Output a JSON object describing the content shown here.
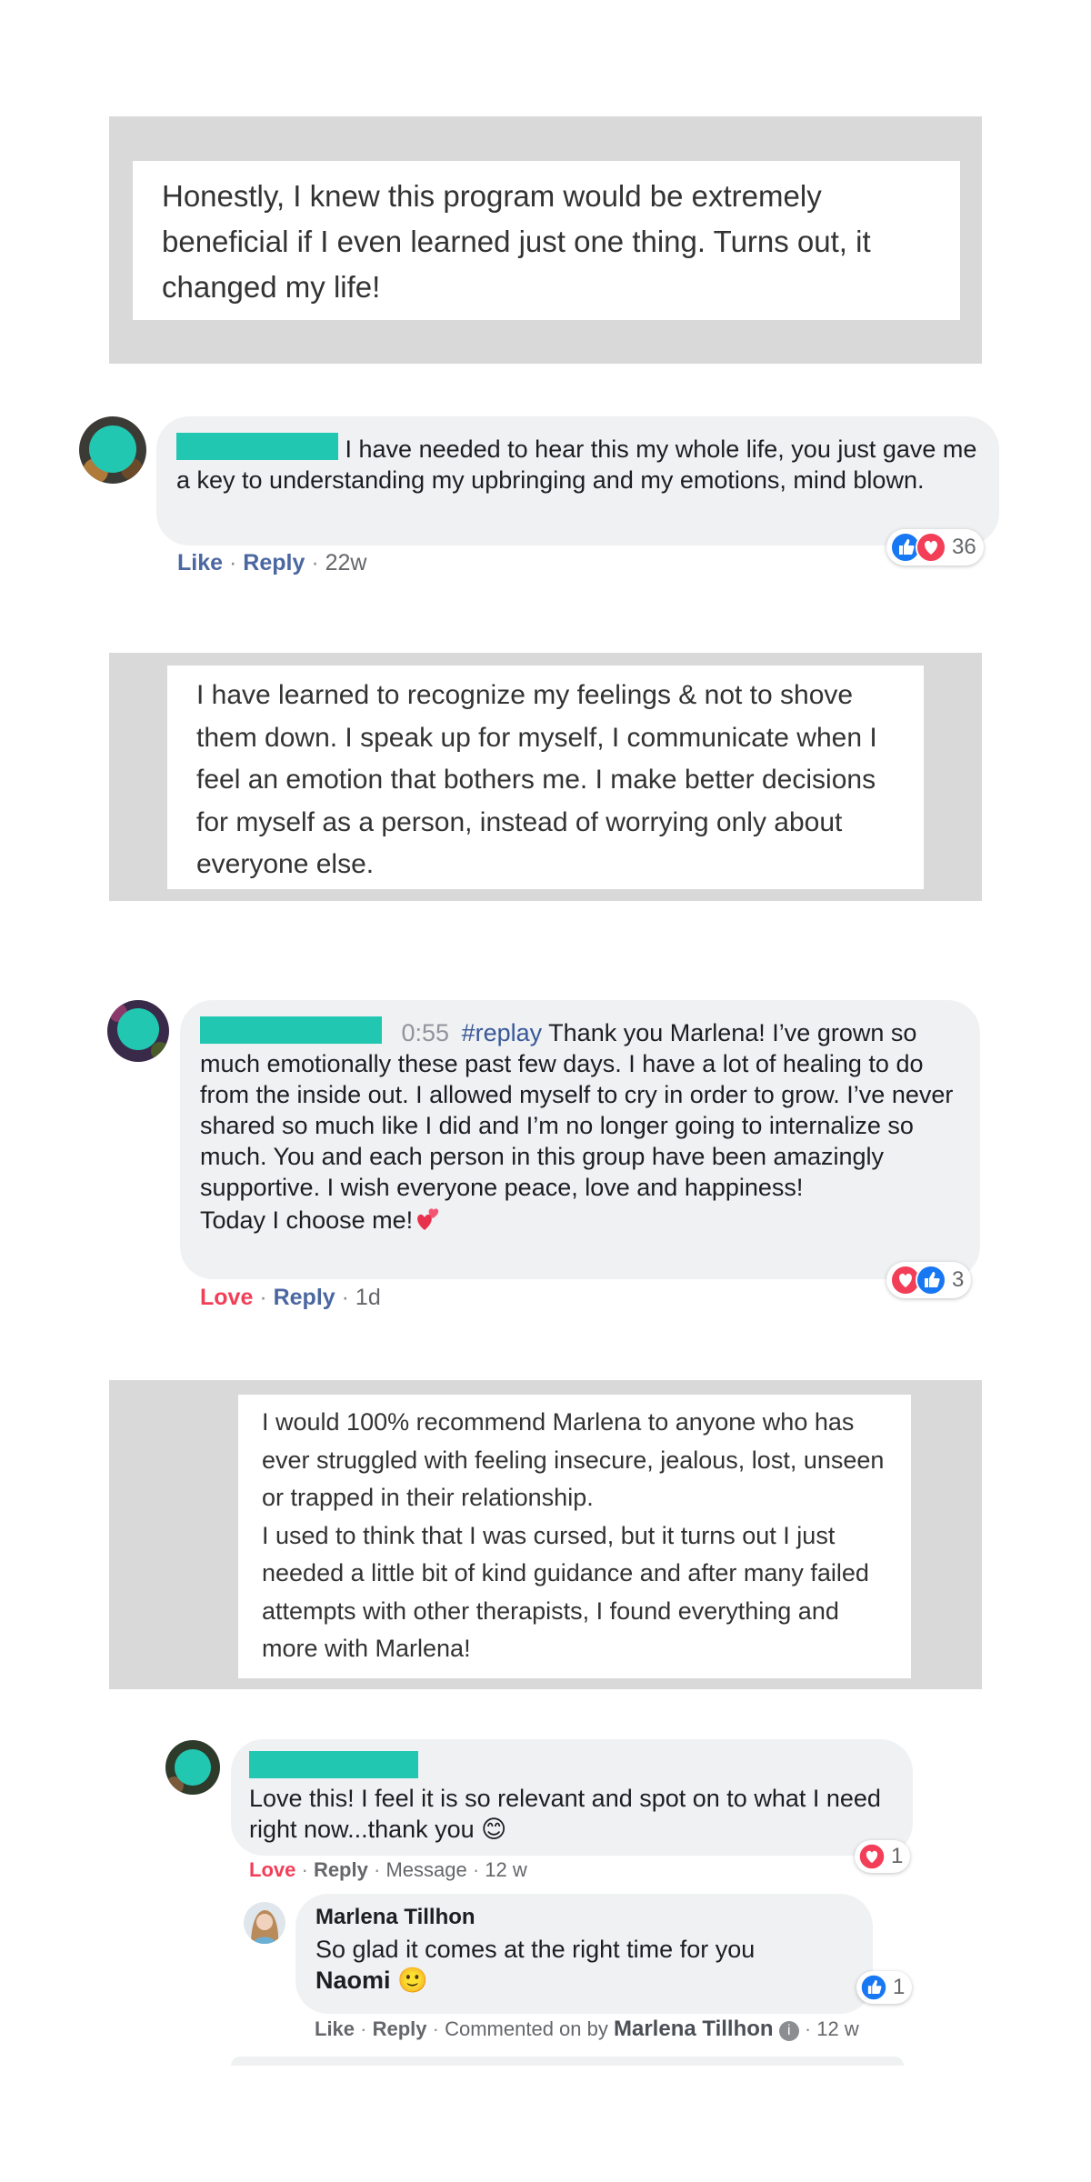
{
  "testimonials": [
    {
      "text": "Honestly, I knew this program would be extremely beneficial if I even learned just one thing. Turns out, it changed my life!"
    },
    {
      "text": "I have learned to recognize my feelings & not to shove them down. I speak up for myself, I communicate when I feel an emotion that bothers me. I make better decisions for myself as a person, instead of worrying only about everyone else."
    },
    {
      "text_p1": "I would 100% recommend Marlena to anyone who has ever struggled with feeling insecure, jealous, lost, unseen or trapped in their relationship.",
      "text_p2": "I used to think that I was cursed, but it turns out I just needed a little bit of kind guidance and after many failed attempts with other therapists, I found everything and more with Marlena!"
    }
  ],
  "comment1": {
    "text": "I have needed to hear this my whole life, you just gave me a key to understanding my upbringing and my emotions, mind blown.",
    "action": "Like",
    "reply": "Reply",
    "time": "22w",
    "reaction_count": "36",
    "reactions": [
      "like-icon",
      "love-icon"
    ]
  },
  "comment2": {
    "timestamp": "0:55",
    "hashtag": "#replay",
    "text_main": "Thank you Marlena! I’ve grown so much emotionally these past few days. I have a lot of healing to do from the inside out. I allowed myself to cry in order to grow. I’ve never shared so much like I did and I’m no longer going to internalize so much. You and each person in this group have been amazingly supportive. I wish everyone peace, love and happiness!",
    "text_last": "Today I choose me!",
    "emoji": "heart-emoji",
    "action": "Love",
    "reply": "Reply",
    "time": "1d",
    "reaction_count": "3",
    "reactions": [
      "love-icon",
      "like-icon"
    ]
  },
  "comment3": {
    "text": "Love this! I feel it is so relevant and spot on to what I need right now...thank you 😊",
    "action": "Love",
    "reply": "Reply",
    "message": "Message",
    "time": "12 w",
    "reaction_count": "1",
    "reactions": [
      "love-icon"
    ]
  },
  "reply1": {
    "author": "Marlena Tillhon",
    "text": "So glad it comes at the right time for you",
    "mention": "Naomi",
    "emoji": "🙂",
    "action": "Like",
    "reply": "Reply",
    "commented_on_by": "Commented on by",
    "commenter": "Marlena Tillhon",
    "time": "12 w",
    "reaction_count": "1",
    "reactions": [
      "like-icon"
    ]
  },
  "colors": {
    "card_bg": "#d9d9d9",
    "bubble_bg": "#eff1f3",
    "redaction": "#22c7b2",
    "link_blue": "#4b67a1",
    "love_red": "#f33e58"
  }
}
